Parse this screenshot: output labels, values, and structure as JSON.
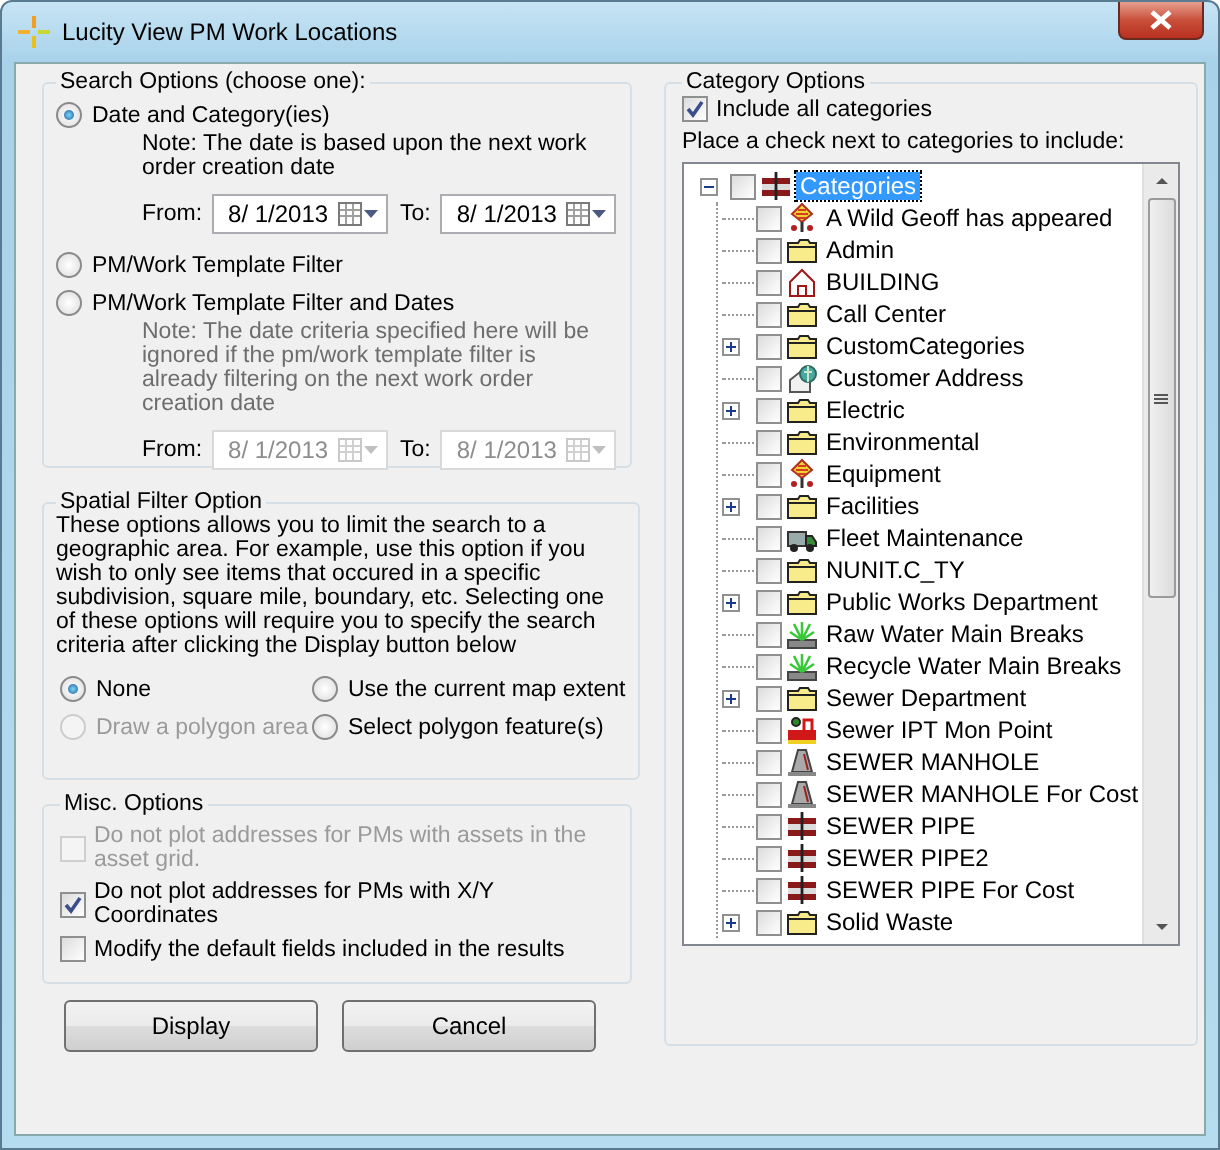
{
  "window": {
    "title": "Lucity View PM Work Locations"
  },
  "search_options": {
    "title": "Search Options (choose one):",
    "options": [
      {
        "label": "Date and Category(ies)",
        "selected": true,
        "note": "Note:  The date is based upon the next work order creation date",
        "dates": {
          "from_label": "From:",
          "from": "8/ 1/2013",
          "to_label": "To:",
          "to": "8/ 1/2013",
          "disabled": false
        }
      },
      {
        "label": "PM/Work Template Filter",
        "selected": false
      },
      {
        "label": "PM/Work Template Filter and Dates",
        "selected": false,
        "note": "Note:  The date criteria specified here will be ignored if the pm/work template filter is already filtering on the next work order creation date",
        "dates": {
          "from_label": "From:",
          "from": "8/ 1/2013",
          "to_label": "To:",
          "to": "8/ 1/2013",
          "disabled": true
        }
      }
    ]
  },
  "spatial_filter": {
    "title": "Spatial Filter Option",
    "description": "These options allows you to limit the search to a geographic area.  For example, use this option if you wish to only see items that occured in a specific subdivision, square mile, boundary, etc.  Selecting one of these options will require you to specify the search criteria after clicking the Display button below",
    "options": [
      {
        "label": "None",
        "selected": true,
        "disabled": false
      },
      {
        "label": "Use the current map extent",
        "selected": false,
        "disabled": false
      },
      {
        "label": "Draw a polygon area",
        "selected": false,
        "disabled": true
      },
      {
        "label": "Select polygon feature(s)",
        "selected": false,
        "disabled": false
      }
    ]
  },
  "misc_options": {
    "title": "Misc. Options",
    "options": [
      {
        "label": "Do not plot addresses for PMs with assets in the asset grid.",
        "checked": false,
        "disabled": true
      },
      {
        "label": "Do not plot addresses for PMs with X/Y Coordinates",
        "checked": true,
        "disabled": false
      },
      {
        "label": "Modify the default fields included in the results",
        "checked": false,
        "disabled": false
      }
    ]
  },
  "category_options": {
    "title": "Category Options",
    "include_all": {
      "label": "Include all categories",
      "checked": true
    },
    "instruction": "Place a check next to categories to include:",
    "tree": [
      {
        "label": "Categories",
        "kind": "pipe",
        "checked": false,
        "selected": true,
        "expandable": true,
        "expanded": true,
        "children": [
          {
            "label": "A Wild Geoff has appeared",
            "kind": "marker",
            "checked": false,
            "selected": false,
            "expandable": false
          },
          {
            "label": "Admin",
            "kind": "folder",
            "checked": false,
            "selected": false,
            "expandable": false
          },
          {
            "label": "BUILDING",
            "kind": "house",
            "checked": false,
            "selected": false,
            "expandable": false
          },
          {
            "label": "Call Center",
            "kind": "folder",
            "checked": false,
            "selected": false,
            "expandable": false
          },
          {
            "label": "CustomCategories",
            "kind": "folder",
            "checked": false,
            "selected": false,
            "expandable": true,
            "expanded": false
          },
          {
            "label": "Customer Address",
            "kind": "address",
            "checked": false,
            "selected": false,
            "expandable": false
          },
          {
            "label": "Electric",
            "kind": "folder",
            "checked": false,
            "selected": false,
            "expandable": true,
            "expanded": false
          },
          {
            "label": "Environmental",
            "kind": "folder",
            "checked": false,
            "selected": false,
            "expandable": false
          },
          {
            "label": "Equipment",
            "kind": "marker",
            "checked": false,
            "selected": false,
            "expandable": false
          },
          {
            "label": "Facilities",
            "kind": "folder",
            "checked": false,
            "selected": false,
            "expandable": true,
            "expanded": false
          },
          {
            "label": "Fleet Maintenance",
            "kind": "truck",
            "checked": false,
            "selected": false,
            "expandable": false
          },
          {
            "label": "NUNIT.C_TY",
            "kind": "folder",
            "checked": false,
            "selected": false,
            "expandable": false
          },
          {
            "label": "Public Works Department",
            "kind": "folder",
            "checked": false,
            "selected": false,
            "expandable": true,
            "expanded": false
          },
          {
            "label": "Raw Water Main Breaks",
            "kind": "break",
            "checked": false,
            "selected": false,
            "expandable": false
          },
          {
            "label": "Recycle Water Main Breaks",
            "kind": "break",
            "checked": false,
            "selected": false,
            "expandable": false
          },
          {
            "label": "Sewer Department",
            "kind": "folder",
            "checked": false,
            "selected": false,
            "expandable": true,
            "expanded": false
          },
          {
            "label": "Sewer IPT Mon Point",
            "kind": "station",
            "checked": false,
            "selected": false,
            "expandable": false
          },
          {
            "label": "SEWER MANHOLE",
            "kind": "manhole",
            "checked": false,
            "selected": false,
            "expandable": false
          },
          {
            "label": "SEWER MANHOLE For Cost",
            "kind": "manhole",
            "checked": false,
            "selected": false,
            "expandable": false
          },
          {
            "label": "SEWER PIPE",
            "kind": "pipe",
            "checked": false,
            "selected": false,
            "expandable": false
          },
          {
            "label": "SEWER PIPE2",
            "kind": "pipe",
            "checked": false,
            "selected": false,
            "expandable": false
          },
          {
            "label": "SEWER PIPE For Cost",
            "kind": "pipe",
            "checked": false,
            "selected": false,
            "expandable": false
          },
          {
            "label": "Solid Waste",
            "kind": "folder",
            "checked": false,
            "selected": false,
            "expandable": true,
            "expanded": false
          }
        ]
      }
    ]
  },
  "buttons": [
    {
      "label": "Display"
    },
    {
      "label": "Cancel"
    }
  ]
}
